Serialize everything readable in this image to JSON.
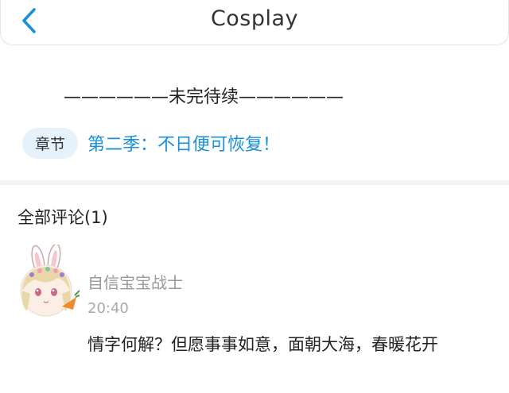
{
  "header": {
    "title": "Cosplay",
    "back_icon": "chevron-left-icon",
    "accent": "#1a8fd8"
  },
  "content": {
    "end_notice": "——————未完待续——————",
    "chapter": {
      "badge": "章节",
      "link_text": "第二季：不日便可恢复！"
    }
  },
  "comments": {
    "heading": "全部评论(1)",
    "items": [
      {
        "avatar": "bunny-girl-avatar",
        "username": "自信宝宝战士",
        "time": "20:40",
        "text": "情字何解？但愿事事如意，面朝大海，春暖花开"
      }
    ]
  }
}
